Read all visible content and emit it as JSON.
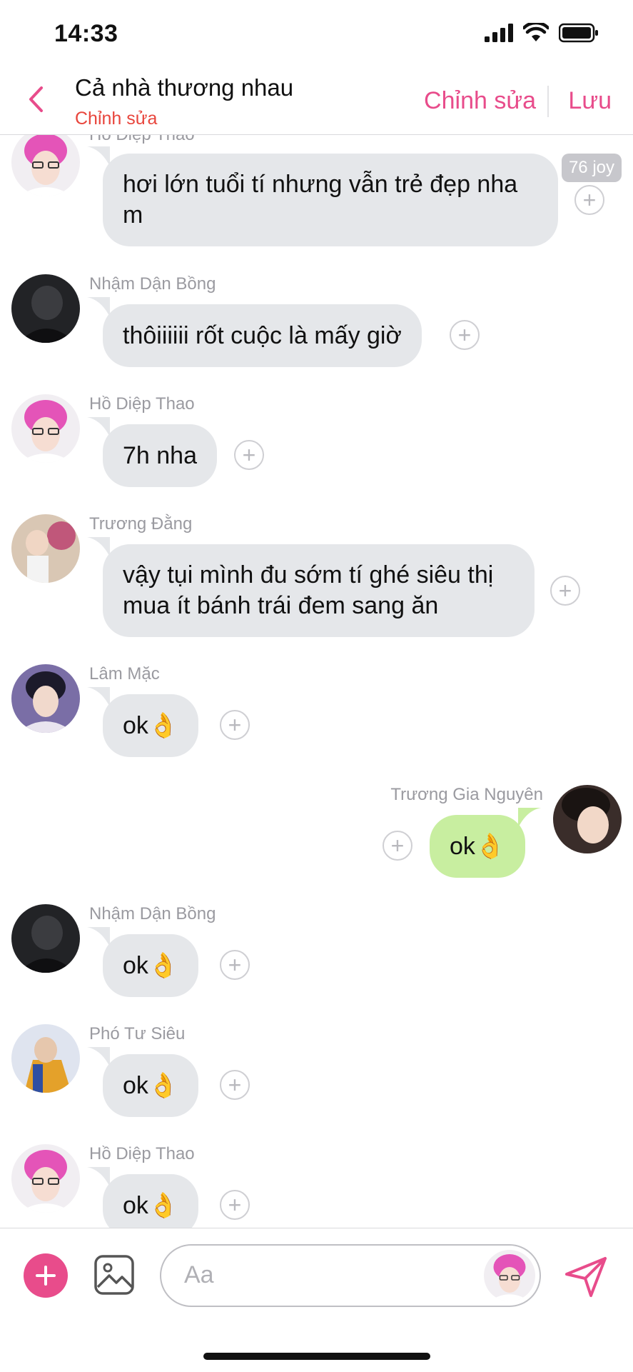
{
  "status": {
    "time": "14:33"
  },
  "header": {
    "title": "Cả nhà thương nhau",
    "subtitle": "Chỉnh sửa",
    "edit_label": "Chỉnh sửa",
    "save_label": "Lưu"
  },
  "messages": [
    {
      "sender": "Hồ Diệp Thao",
      "text": "hơi lớn tuổi tí nhưng vẫn trẻ đẹp nha m",
      "reaction_badge": "76 joy",
      "avatar": "pink-hair"
    },
    {
      "sender": "Nhậm Dận Bồng",
      "text": "thôiiiiii rốt cuộc là mấy giờ",
      "avatar": "dark"
    },
    {
      "sender": "Hồ Diệp Thao",
      "text": "7h nha",
      "avatar": "pink-hair"
    },
    {
      "sender": "Trương Đằng",
      "text": "vậy tụi mình đu sớm tí ghé siêu thị mua ít bánh trái đem sang ăn",
      "avatar": "mirror"
    },
    {
      "sender": "Lâm Mặc",
      "text": "ok👌",
      "avatar": "purple"
    },
    {
      "sender": "Trương Gia Nguyên",
      "text": "ok👌",
      "avatar": "self",
      "outgoing": true
    },
    {
      "sender": "Nhậm Dận Bồng",
      "text": "ok👌",
      "avatar": "dark"
    },
    {
      "sender": "Phó Tư Siêu",
      "text": "ok👌",
      "avatar": "yellow"
    },
    {
      "sender": "Hồ Diệp Thao",
      "text": "ok👌",
      "avatar": "pink-hair"
    }
  ],
  "composer": {
    "placeholder": "Aa"
  },
  "colors": {
    "accent": "#e84c8b",
    "subtitle": "#e8453c",
    "bubble_in": "#e5e7ea",
    "bubble_out": "#c8eea0"
  }
}
